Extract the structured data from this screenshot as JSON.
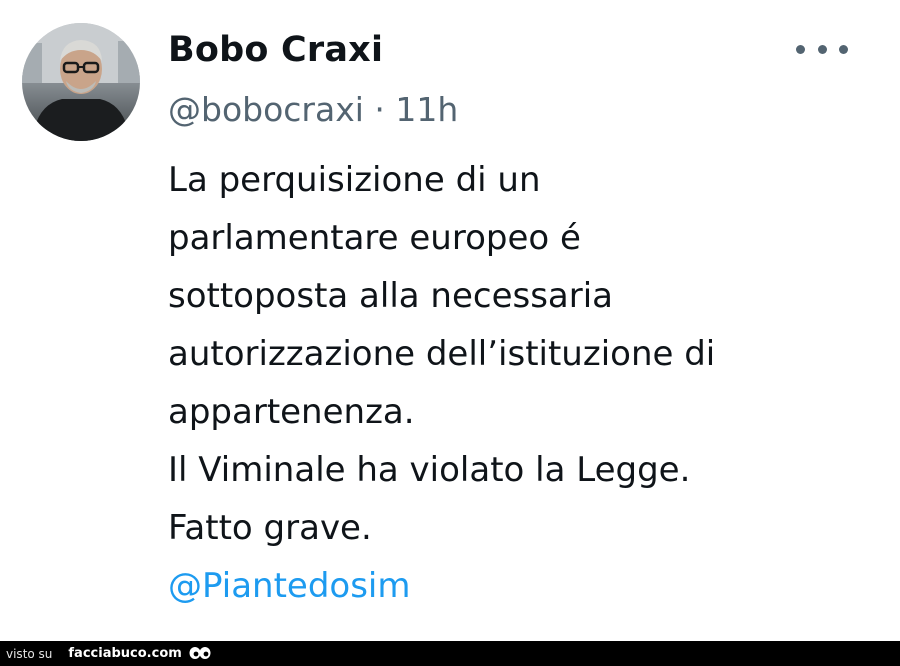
{
  "tweet": {
    "author_name": "Bobo Craxi",
    "handle": "@bobocraxi",
    "separator": "·",
    "time": "11h",
    "text_lines": [
      "La perquisizione di un",
      "parlamentare europeo é",
      "sottoposta alla necessaria",
      "autorizzazione dell’istituzione di",
      "appartenenza.",
      "Il Viminale ha violato la Legge.",
      "Fatto grave."
    ],
    "mention": "@Piantedosim"
  },
  "icons": {
    "more": "more-horizontal-icon",
    "avatar": "user-avatar"
  },
  "colors": {
    "text": "#0f1419",
    "secondary": "#536471",
    "link": "#1d9bf0",
    "footer_bg": "#000000"
  },
  "footer": {
    "visto_su": "visto su",
    "site": "facciabuco.com"
  }
}
